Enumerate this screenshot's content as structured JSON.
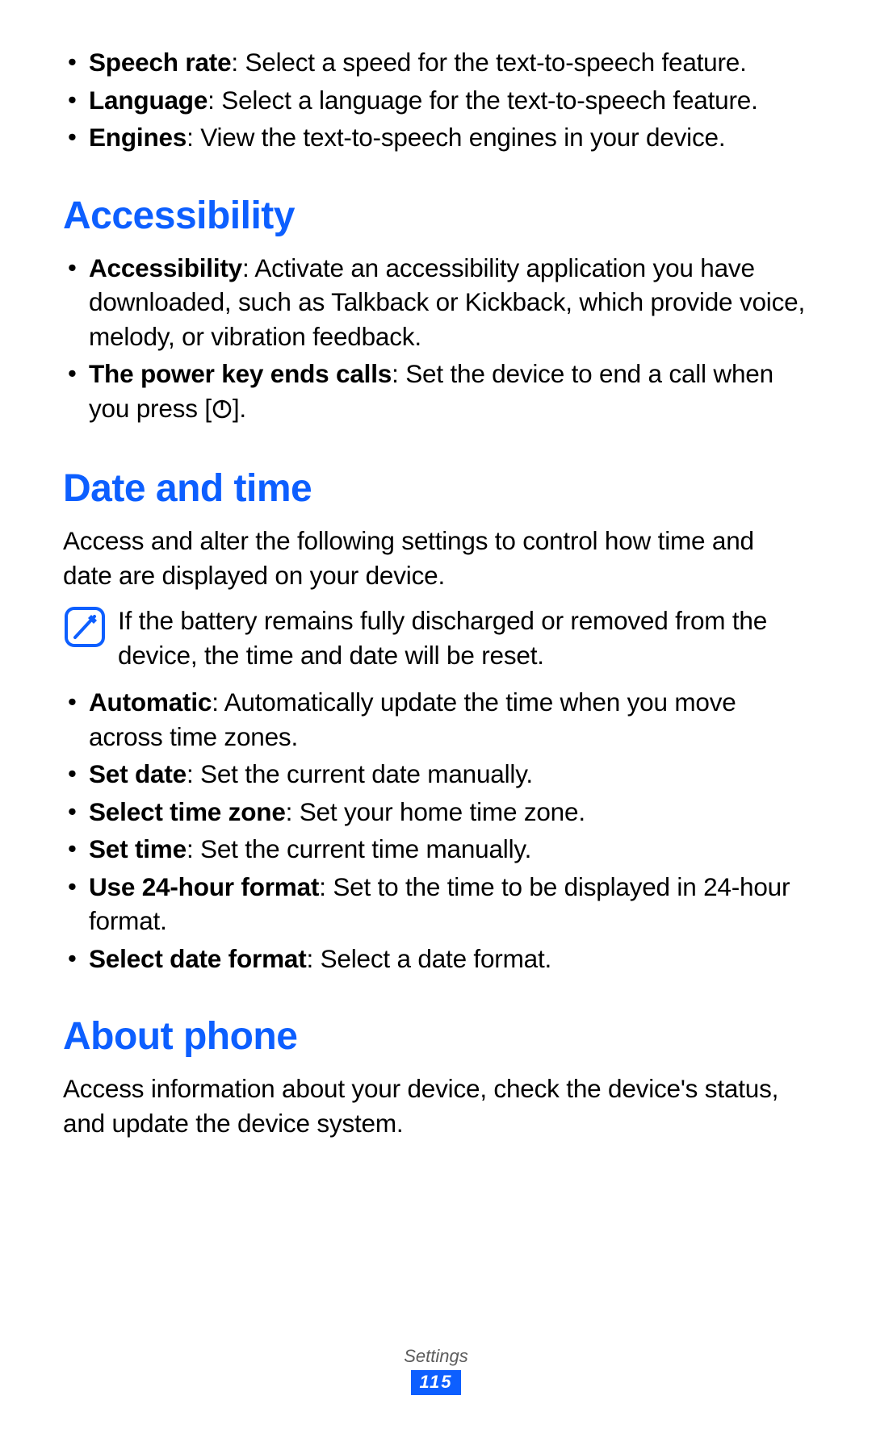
{
  "top_bullets": [
    {
      "label": "Speech rate",
      "desc": ": Select a speed for the text-to-speech feature."
    },
    {
      "label": "Language",
      "desc": ": Select a language for the text-to-speech feature."
    },
    {
      "label": "Engines",
      "desc": ": View the text-to-speech engines in your device."
    }
  ],
  "sections": {
    "accessibility": {
      "heading": "Accessibility",
      "items": [
        {
          "label": "Accessibility",
          "desc": ": Activate an accessibility application you have downloaded, such as Talkback or Kickback, which provide voice, melody, or vibration feedback."
        },
        {
          "label": "The power key ends calls",
          "desc_before": ": Set the device to end a call when you press [",
          "desc_after": "]."
        }
      ]
    },
    "date_time": {
      "heading": "Date and time",
      "intro": "Access and alter the following settings to control how time and date are displayed on your device.",
      "note": "If the battery remains fully discharged or removed from the device, the time and date will be reset.",
      "items": [
        {
          "label": "Automatic",
          "desc": ": Automatically update the time when you move across time zones."
        },
        {
          "label": "Set date",
          "desc": ": Set the current date manually."
        },
        {
          "label": "Select time zone",
          "desc": ": Set your home time zone."
        },
        {
          "label": "Set time",
          "desc": ": Set the current time manually."
        },
        {
          "label": "Use 24-hour format",
          "desc": ": Set to the time to be displayed in 24-hour format."
        },
        {
          "label": "Select date format",
          "desc": ": Select a date format."
        }
      ]
    },
    "about_phone": {
      "heading": "About phone",
      "intro": "Access information about your device, check the device's status, and update the device system."
    }
  },
  "footer": {
    "section": "Settings",
    "page": "115"
  }
}
